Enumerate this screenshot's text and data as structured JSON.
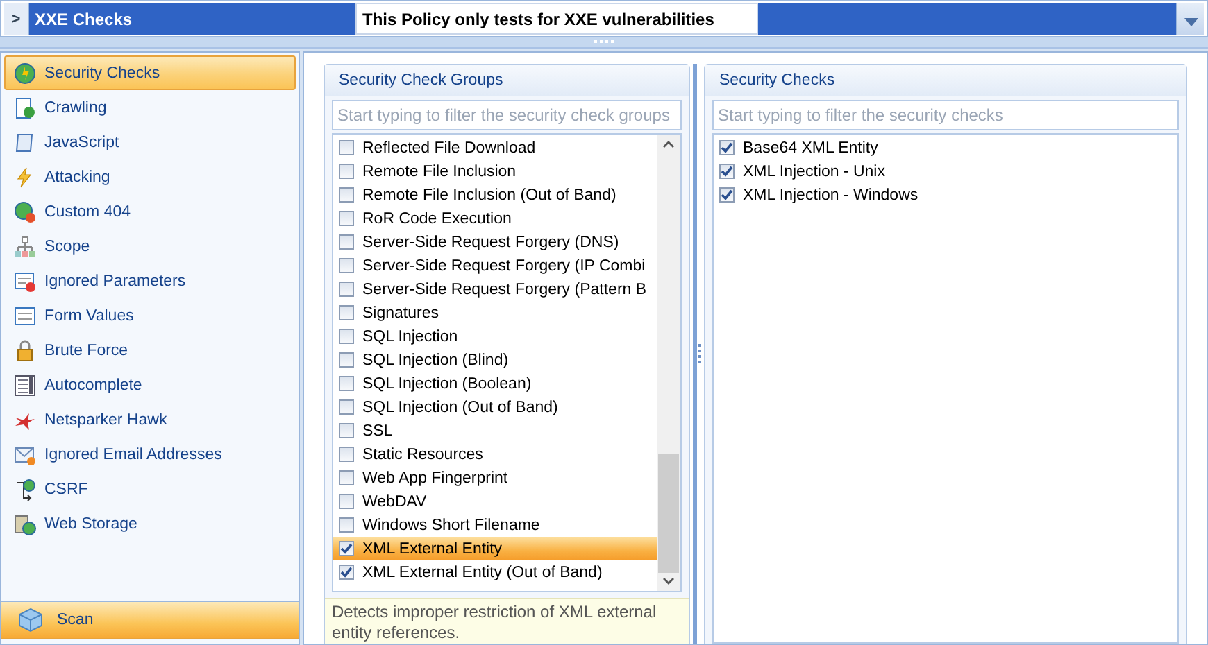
{
  "policy_row": {
    "name": "XXE Checks",
    "description": "This Policy only tests for XXE vulnerabilities",
    "expander": ">"
  },
  "sidebar": {
    "items": [
      {
        "label": "Security Checks",
        "selected": true
      },
      {
        "label": "Crawling",
        "selected": false
      },
      {
        "label": "JavaScript",
        "selected": false
      },
      {
        "label": "Attacking",
        "selected": false
      },
      {
        "label": "Custom 404",
        "selected": false
      },
      {
        "label": "Scope",
        "selected": false
      },
      {
        "label": "Ignored Parameters",
        "selected": false
      },
      {
        "label": "Form Values",
        "selected": false
      },
      {
        "label": "Brute Force",
        "selected": false
      },
      {
        "label": "Autocomplete",
        "selected": false
      },
      {
        "label": "Netsparker Hawk",
        "selected": false
      },
      {
        "label": "Ignored Email Addresses",
        "selected": false
      },
      {
        "label": "CSRF",
        "selected": false
      },
      {
        "label": "Web Storage",
        "selected": false
      }
    ],
    "scan_button": "Scan"
  },
  "groups_panel": {
    "title": "Security Check Groups",
    "placeholder": "Start typing to filter the security check groups",
    "items": [
      {
        "label": "Reflected File Download",
        "checked": false,
        "selected": false
      },
      {
        "label": "Remote File Inclusion",
        "checked": false,
        "selected": false
      },
      {
        "label": "Remote File Inclusion (Out of Band)",
        "checked": false,
        "selected": false
      },
      {
        "label": "RoR Code Execution",
        "checked": false,
        "selected": false
      },
      {
        "label": "Server-Side Request Forgery (DNS)",
        "checked": false,
        "selected": false
      },
      {
        "label": "Server-Side Request Forgery (IP Combi",
        "checked": false,
        "selected": false
      },
      {
        "label": "Server-Side Request Forgery (Pattern B",
        "checked": false,
        "selected": false
      },
      {
        "label": "Signatures",
        "checked": false,
        "selected": false
      },
      {
        "label": "SQL Injection",
        "checked": false,
        "selected": false
      },
      {
        "label": "SQL Injection (Blind)",
        "checked": false,
        "selected": false
      },
      {
        "label": "SQL Injection (Boolean)",
        "checked": false,
        "selected": false
      },
      {
        "label": "SQL Injection (Out of Band)",
        "checked": false,
        "selected": false
      },
      {
        "label": "SSL",
        "checked": false,
        "selected": false
      },
      {
        "label": "Static Resources",
        "checked": false,
        "selected": false
      },
      {
        "label": "Web App Fingerprint",
        "checked": false,
        "selected": false
      },
      {
        "label": "WebDAV",
        "checked": false,
        "selected": false
      },
      {
        "label": "Windows Short Filename",
        "checked": false,
        "selected": false
      },
      {
        "label": "XML External Entity",
        "checked": true,
        "selected": true
      },
      {
        "label": "XML External Entity (Out of Band)",
        "checked": true,
        "selected": false
      }
    ],
    "description": "Detects improper restriction of XML external entity references."
  },
  "checks_panel": {
    "title": "Security Checks",
    "placeholder": "Start typing to filter the security checks",
    "items": [
      {
        "label": "Base64 XML Entity",
        "checked": true
      },
      {
        "label": "XML Injection - Unix",
        "checked": true
      },
      {
        "label": "XML Injection - Windows",
        "checked": true
      }
    ]
  }
}
